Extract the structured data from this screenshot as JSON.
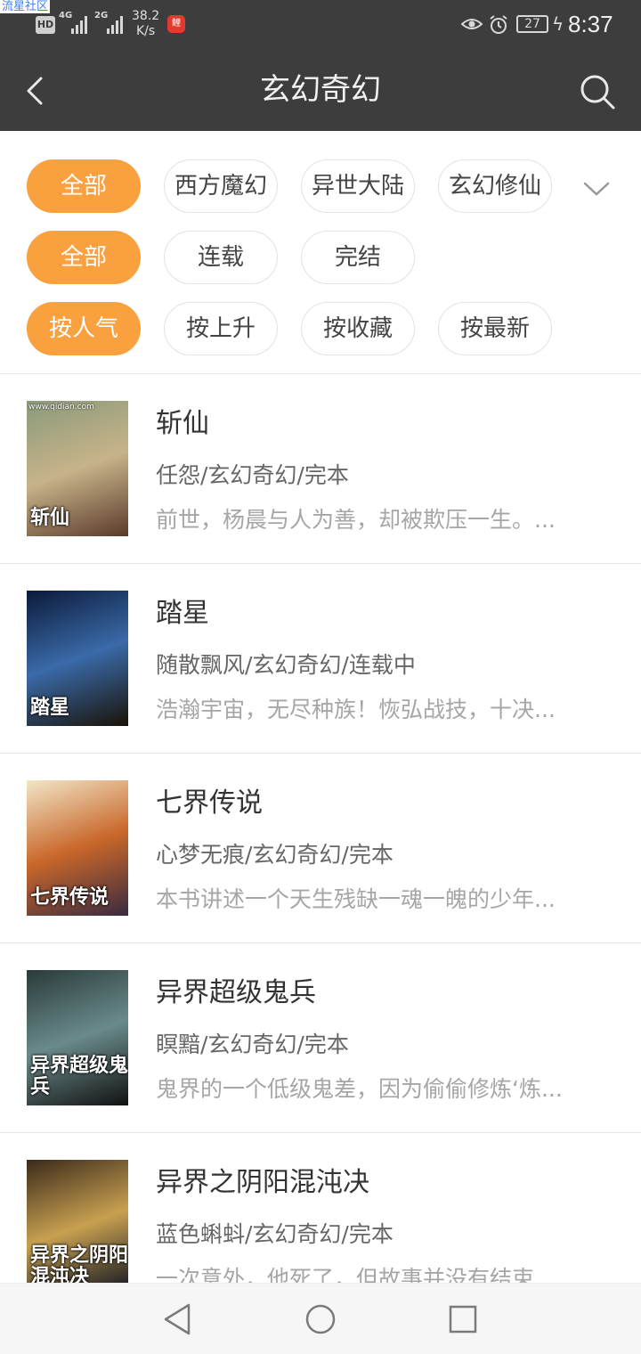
{
  "status_bar": {
    "watermark": "流星社区",
    "hd_label": "HD",
    "sim1_gen": "4G",
    "sim2_gen": "2G",
    "net_speed_value": "38.2",
    "net_speed_unit": "K/s",
    "app_icon_label": "鲤",
    "battery_level": "27",
    "time": "8:37"
  },
  "header": {
    "title": "玄幻奇幻",
    "icons": {
      "back": "back-arrow-icon",
      "search": "search-icon"
    }
  },
  "filters": {
    "category_row": [
      {
        "label": "全部",
        "active": true
      },
      {
        "label": "西方魔幻",
        "active": false
      },
      {
        "label": "异世大陆",
        "active": false
      },
      {
        "label": "玄幻修仙",
        "active": false
      }
    ],
    "status_row": [
      {
        "label": "全部",
        "active": true
      },
      {
        "label": "连载",
        "active": false
      },
      {
        "label": "完结",
        "active": false
      }
    ],
    "sort_row": [
      {
        "label": "按人气",
        "active": true
      },
      {
        "label": "按上升",
        "active": false
      },
      {
        "label": "按收藏",
        "active": false
      },
      {
        "label": "按最新",
        "active": false
      }
    ],
    "accent_color": "#f9a03f"
  },
  "books": [
    {
      "name": "斩仙",
      "meta": "任怨/玄幻奇幻/完本",
      "desc": "前世，杨晨与人为善，却被欺压一生。...",
      "cover_text": "斩仙",
      "cover_url": "www.qidian.com",
      "cover_colors": [
        "#8a9a7a",
        "#c7b38a",
        "#5a3a2a"
      ]
    },
    {
      "name": "踏星",
      "meta": "随散飘风/玄幻奇幻/连载中",
      "desc": "浩瀚宇宙，无尽种族！恢弘战技，十决...",
      "cover_text": "踏星",
      "cover_url": "",
      "cover_colors": [
        "#0b1a3a",
        "#3a6aa8",
        "#1a1208"
      ]
    },
    {
      "name": "七界传说",
      "meta": "心梦无痕/玄幻奇幻/完本",
      "desc": "本书讲述一个天生残缺一魂一魄的少年...",
      "cover_text": "七界传说",
      "cover_url": "",
      "cover_colors": [
        "#f2e6c8",
        "#c9672a",
        "#3a2a40"
      ]
    },
    {
      "name": "异界超级鬼兵",
      "meta": "瞑黯/玄幻奇幻/完本",
      "desc": "鬼界的一个低级鬼差，因为偷偷修炼‘炼...",
      "cover_text": "异界超级鬼兵",
      "cover_url": "",
      "cover_colors": [
        "#2a3a3a",
        "#6a8a8a",
        "#111"
      ]
    },
    {
      "name": "异界之阴阳混沌决",
      "meta": "蓝色蝌蚪/玄幻奇幻/完本",
      "desc": "一次意外，他死了，但故事并没有结束...",
      "cover_text": "异界之阴阳混沌决",
      "cover_url": "",
      "cover_colors": [
        "#3a2a1a",
        "#c8a050",
        "#0a1020"
      ]
    }
  ],
  "nav": {
    "back": "nav-back-icon",
    "home": "nav-home-icon",
    "recents": "nav-recents-icon"
  }
}
